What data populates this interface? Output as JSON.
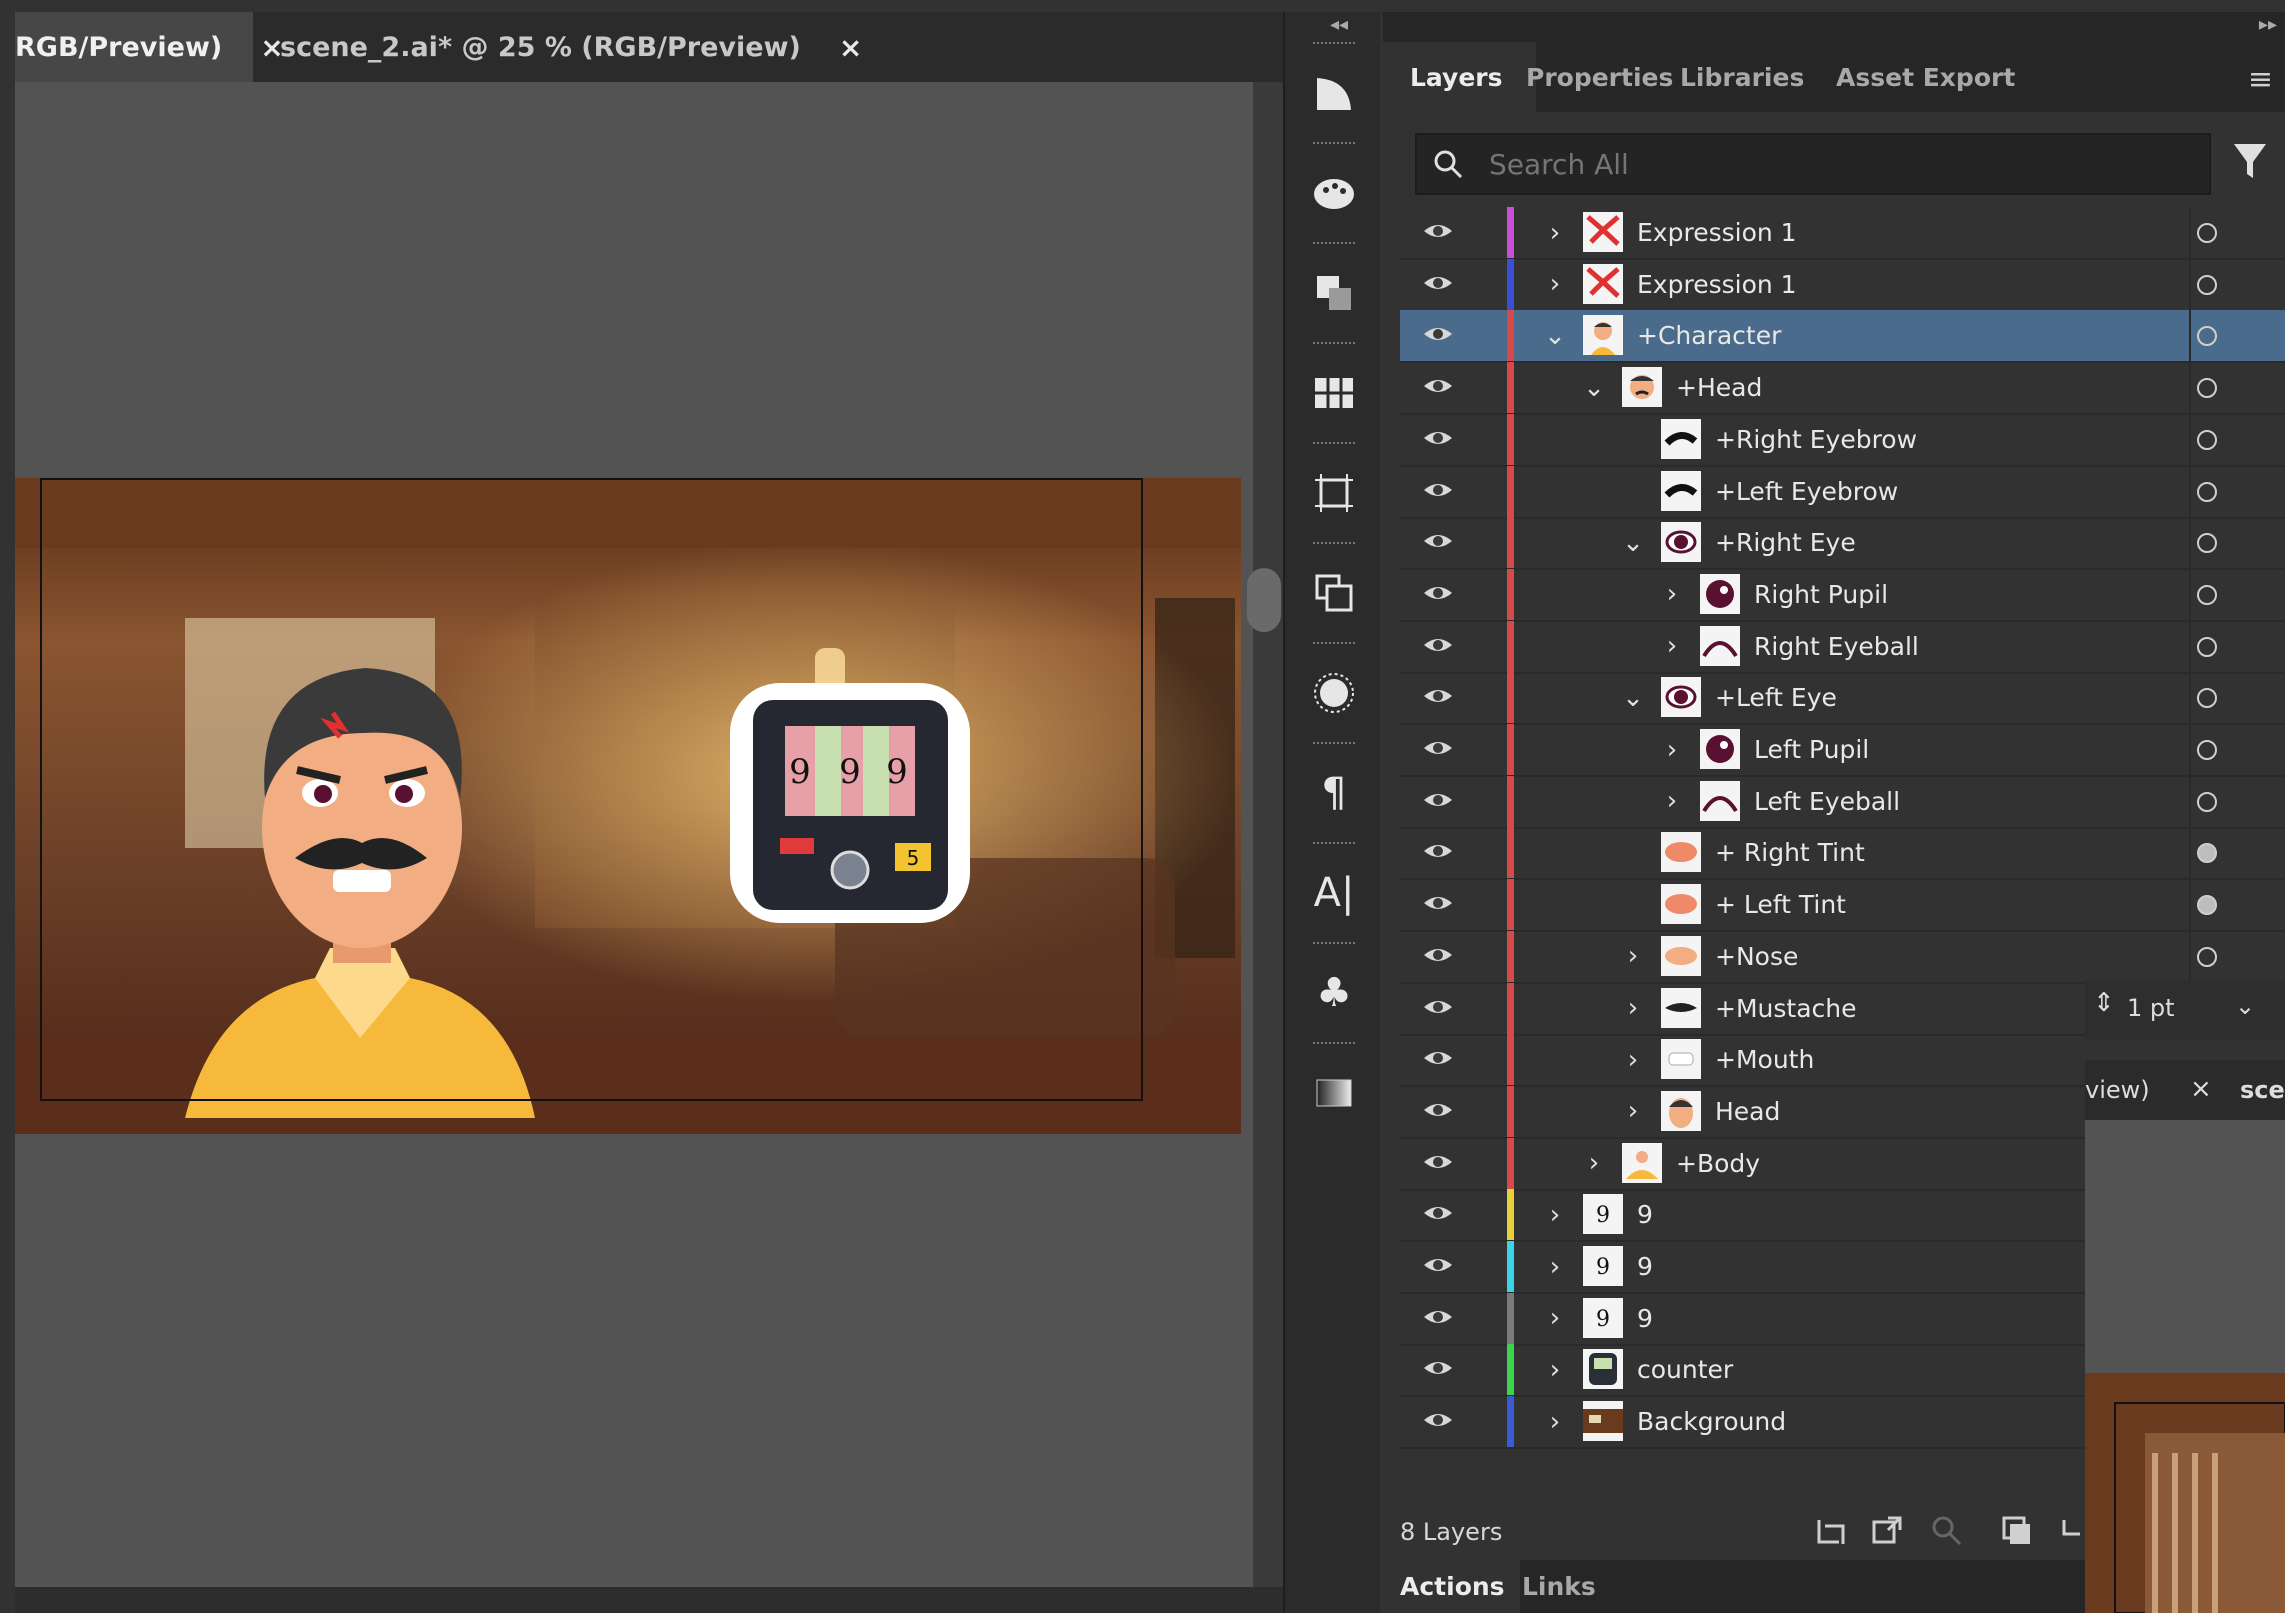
{
  "document_tabs": [
    {
      "label": "RGB/Preview)",
      "close": "×"
    },
    {
      "label": "scene_2.ai* @ 25 % (RGB/Preview)",
      "close": "×"
    }
  ],
  "artwork": {
    "counter_digits": [
      "9",
      "9",
      "9"
    ],
    "counter_badge": "5"
  },
  "panel_tabs": [
    "Layers",
    "Properties",
    "Libraries",
    "Asset Export"
  ],
  "search": {
    "placeholder": "Search All"
  },
  "layers": [
    {
      "name": "Expression 1",
      "color": "#c94fd6",
      "arrow": "›",
      "target": "empty",
      "thumb": "expression"
    },
    {
      "name": "Expression 1",
      "color": "#3a4fd6",
      "arrow": "›",
      "target": "empty",
      "thumb": "expression"
    },
    {
      "name": "+Character",
      "color": "#d64a4a",
      "arrow": "⌄",
      "target": "empty",
      "thumb": "character",
      "selected": true
    },
    {
      "name": "+Head",
      "color": "#d64a4a",
      "arrow": "⌄",
      "target": "empty",
      "thumb": "head"
    },
    {
      "name": "+Right Eyebrow",
      "color": "#d64a4a",
      "arrow": "",
      "target": "empty",
      "thumb": "brow"
    },
    {
      "name": "+Left Eyebrow",
      "color": "#d64a4a",
      "arrow": "",
      "target": "empty",
      "thumb": "brow"
    },
    {
      "name": "+Right Eye",
      "color": "#d64a4a",
      "arrow": "⌄",
      "target": "empty",
      "thumb": "eye"
    },
    {
      "name": "Right Pupil",
      "color": "#d64a4a",
      "arrow": "›",
      "target": "empty",
      "thumb": "pupil"
    },
    {
      "name": "Right Eyeball",
      "color": "#d64a4a",
      "arrow": "›",
      "target": "empty",
      "thumb": "eyeball"
    },
    {
      "name": "+Left Eye",
      "color": "#d64a4a",
      "arrow": "⌄",
      "target": "empty",
      "thumb": "eye"
    },
    {
      "name": "Left Pupil",
      "color": "#d64a4a",
      "arrow": "›",
      "target": "empty",
      "thumb": "pupil"
    },
    {
      "name": "Left Eyeball",
      "color": "#d64a4a",
      "arrow": "›",
      "target": "empty",
      "thumb": "eyeball"
    },
    {
      "name": "+ Right Tint",
      "color": "#d64a4a",
      "arrow": "",
      "target": "filled",
      "thumb": "tint"
    },
    {
      "name": "+ Left Tint",
      "color": "#d64a4a",
      "arrow": "",
      "target": "filled",
      "thumb": "tint"
    },
    {
      "name": "+Nose",
      "color": "#d64a4a",
      "arrow": "›",
      "target": "empty",
      "thumb": "nose"
    },
    {
      "name": "+Mustache",
      "color": "#d64a4a",
      "arrow": "›",
      "target": "none",
      "thumb": "mustache"
    },
    {
      "name": "+Mouth",
      "color": "#d64a4a",
      "arrow": "›",
      "target": "none",
      "thumb": "mouth"
    },
    {
      "name": "Head",
      "color": "#d64a4a",
      "arrow": "›",
      "target": "none",
      "thumb": "headbase"
    },
    {
      "name": "+Body",
      "color": "#d64a4a",
      "arrow": "›",
      "target": "none",
      "thumb": "body"
    },
    {
      "name": "9",
      "color": "#e8d23a",
      "arrow": "›",
      "target": "none",
      "thumb": "nine"
    },
    {
      "name": "9",
      "color": "#3ad6e8",
      "arrow": "›",
      "target": "none",
      "thumb": "nine"
    },
    {
      "name": "9",
      "color": "#7a7a7a",
      "arrow": "›",
      "target": "none",
      "thumb": "nine"
    },
    {
      "name": "counter",
      "color": "#3ad64a",
      "arrow": "›",
      "target": "none",
      "thumb": "counter"
    },
    {
      "name": "Background",
      "color": "#3a5ad6",
      "arrow": "›",
      "target": "none",
      "thumb": "background"
    }
  ],
  "footer": {
    "layer_count": "8 Layers"
  },
  "bottom_tabs": [
    "Actions",
    "Links"
  ],
  "floating": {
    "stroke_value": "1 pt",
    "tab_label": "view)",
    "tab_close": "×",
    "tab2_label": "scer"
  },
  "colors": {
    "accent_selected": "#4a6b8c",
    "panel_bg": "#323232",
    "canvas_bg": "#535353"
  }
}
